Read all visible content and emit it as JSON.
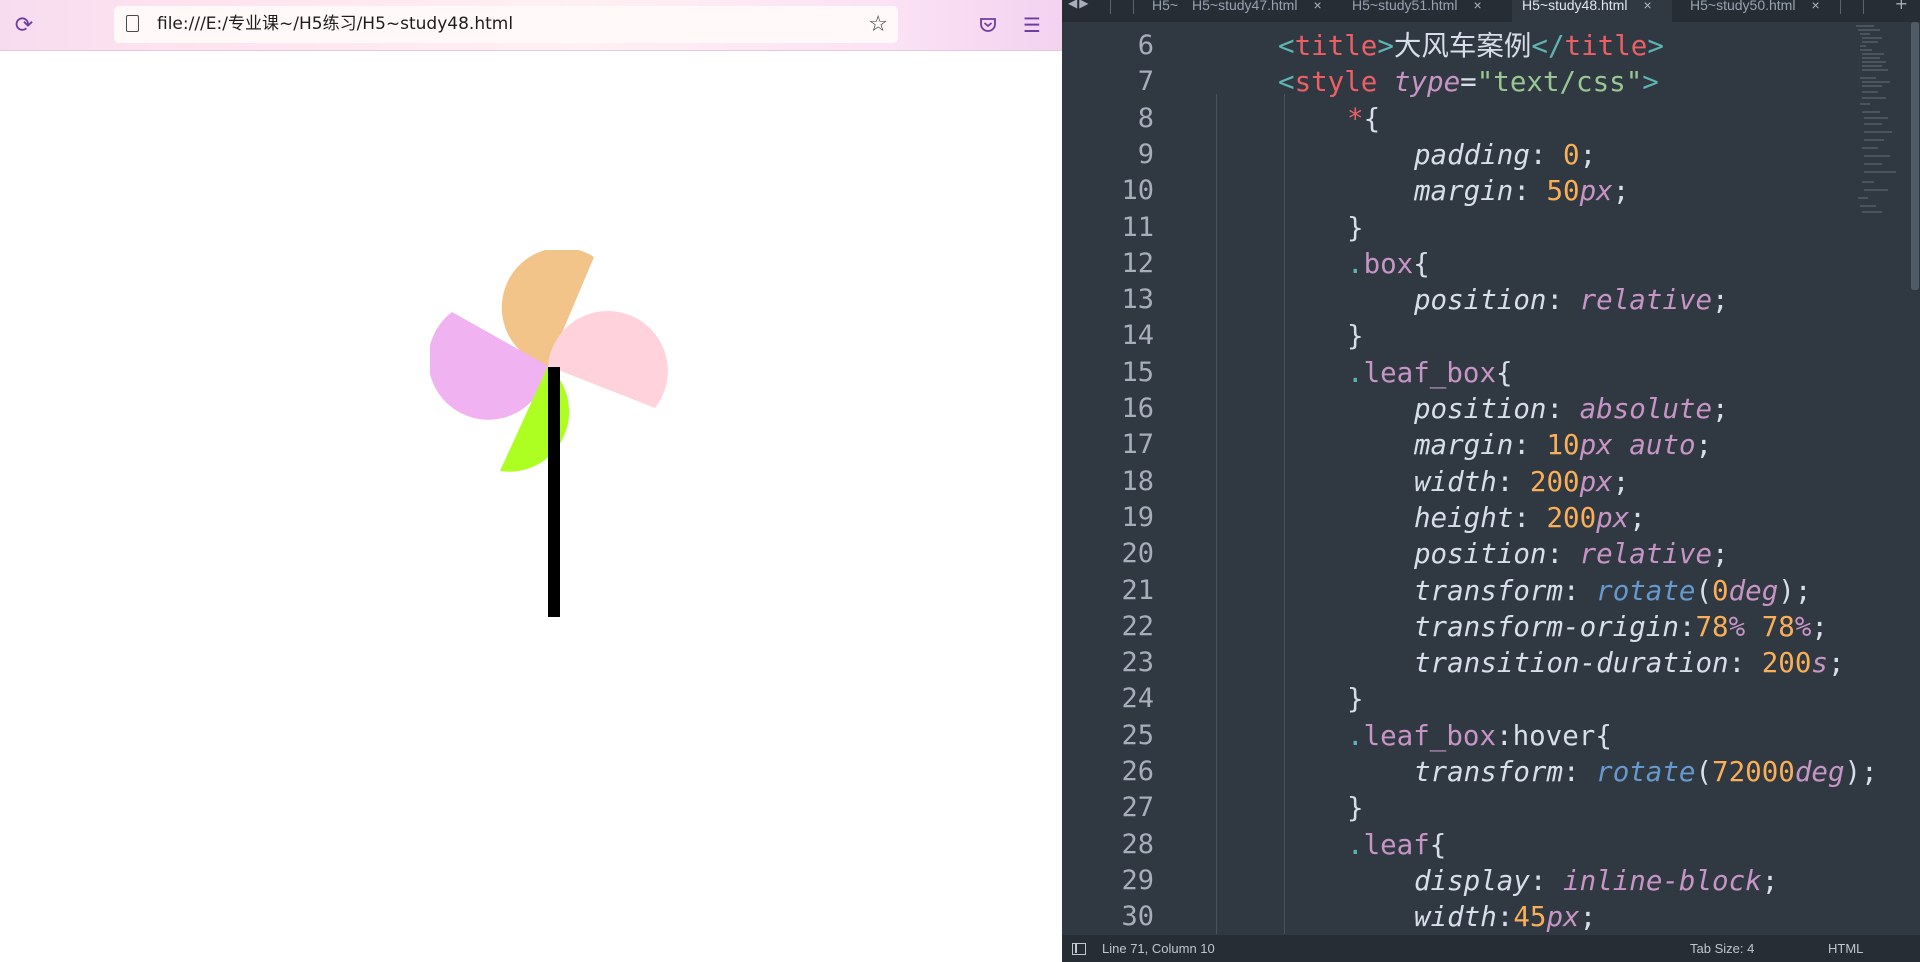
{
  "browser": {
    "url": "file:///E:/专业课~/H5练习/H5~study48.html",
    "icons": {
      "reload": "reload-icon",
      "page": "page-icon",
      "bookmark": "star-icon",
      "pocket": "pocket-icon",
      "menu": "hamburger-menu-icon"
    }
  },
  "pinwheel": {
    "colors": {
      "top_blade": "#f2c48a",
      "left_blade": "#f0b2f0",
      "right_blade": "#ffd2dc",
      "bottom_blade": "#adff22",
      "stick": "#000000"
    }
  },
  "editor": {
    "tabs": [
      {
        "label": "H5~",
        "active": false
      },
      {
        "label": "H5~study47.html",
        "active": false
      },
      {
        "label": "H5~study51.html",
        "active": false
      },
      {
        "label": "H5~study48.html",
        "active": true
      },
      {
        "label": "H5~study50.html",
        "active": false
      }
    ],
    "tab_close": "×",
    "tab_add": "+",
    "line_numbers": [
      "6",
      "7",
      "8",
      "9",
      "10",
      "11",
      "12",
      "13",
      "14",
      "15",
      "16",
      "17",
      "18",
      "19",
      "20",
      "21",
      "22",
      "23",
      "24",
      "25",
      "26",
      "27",
      "28",
      "29",
      "30"
    ],
    "code": {
      "l6": {
        "open": "<",
        "tag": "title",
        "close": ">",
        "text": "大风车案例",
        "end_open": "</",
        "end_tag": "title",
        "end_close": ">"
      },
      "l7": {
        "open": "<",
        "tag": "style",
        "attr": "type",
        "eq": "=",
        "val": "\"text/css\"",
        "close": ">"
      },
      "l8": {
        "sel": "*",
        "brace": "{"
      },
      "l9": {
        "prop": "padding",
        "colon": ": ",
        "num": "0",
        "semi": ";"
      },
      "l10": {
        "prop": "margin",
        "colon": ": ",
        "num": "50",
        "unit": "px",
        "semi": ";"
      },
      "l11": {
        "brace": "}"
      },
      "l12": {
        "dot": ".",
        "cls": "box",
        "brace": "{"
      },
      "l13": {
        "prop": "position",
        "colon": ": ",
        "kw": "relative",
        "semi": ";"
      },
      "l14": {
        "brace": "}"
      },
      "l15": {
        "dot": ".",
        "cls": "leaf_box",
        "brace": "{"
      },
      "l16": {
        "prop": "position",
        "colon": ": ",
        "kw": "absolute",
        "semi": ";"
      },
      "l17": {
        "prop": "margin",
        "colon": ": ",
        "num": "10",
        "unit": "px",
        "kw": " auto",
        "semi": ";"
      },
      "l18": {
        "prop": "width",
        "colon": ": ",
        "num": "200",
        "unit": "px",
        "semi": ";"
      },
      "l19": {
        "prop": "height",
        "colon": ": ",
        "num": "200",
        "unit": "px",
        "semi": ";"
      },
      "l20": {
        "prop": "position",
        "colon": ": ",
        "kw": "relative",
        "semi": ";"
      },
      "l21": {
        "prop": "transform",
        "colon": ": ",
        "fn": "rotate",
        "po": "(",
        "num": "0",
        "unit": "deg",
        "pc": ")",
        "semi": ";"
      },
      "l22": {
        "prop": "transform-origin",
        "colon": ":",
        "num": "78",
        "unit": "%",
        "num2": " 78",
        "unit2": "%",
        "semi": ";"
      },
      "l23": {
        "prop": "transition-duration",
        "colon": ": ",
        "num": "200",
        "unit": "s",
        "semi": ";"
      },
      "l24": {
        "brace": "}"
      },
      "l25": {
        "dot": ".",
        "cls": "leaf_box",
        "pseudo": ":hover",
        "brace": "{"
      },
      "l26": {
        "prop": "transform",
        "colon": ": ",
        "fn": "rotate",
        "po": "(",
        "num": "72000",
        "unit": "deg",
        "pc": ")",
        "semi": ";"
      },
      "l27": {
        "brace": "}"
      },
      "l28": {
        "dot": ".",
        "cls": "leaf",
        "brace": "{"
      },
      "l29": {
        "prop": "display",
        "colon": ": ",
        "kw": "inline-block",
        "semi": ";"
      },
      "l30": {
        "prop": "width",
        "colon": ":",
        "num": "45",
        "unit": "px",
        "semi": ";"
      }
    },
    "status": {
      "position": "Line 71, Column 10",
      "tab_size": "Tab Size: 4",
      "syntax": "HTML"
    }
  }
}
